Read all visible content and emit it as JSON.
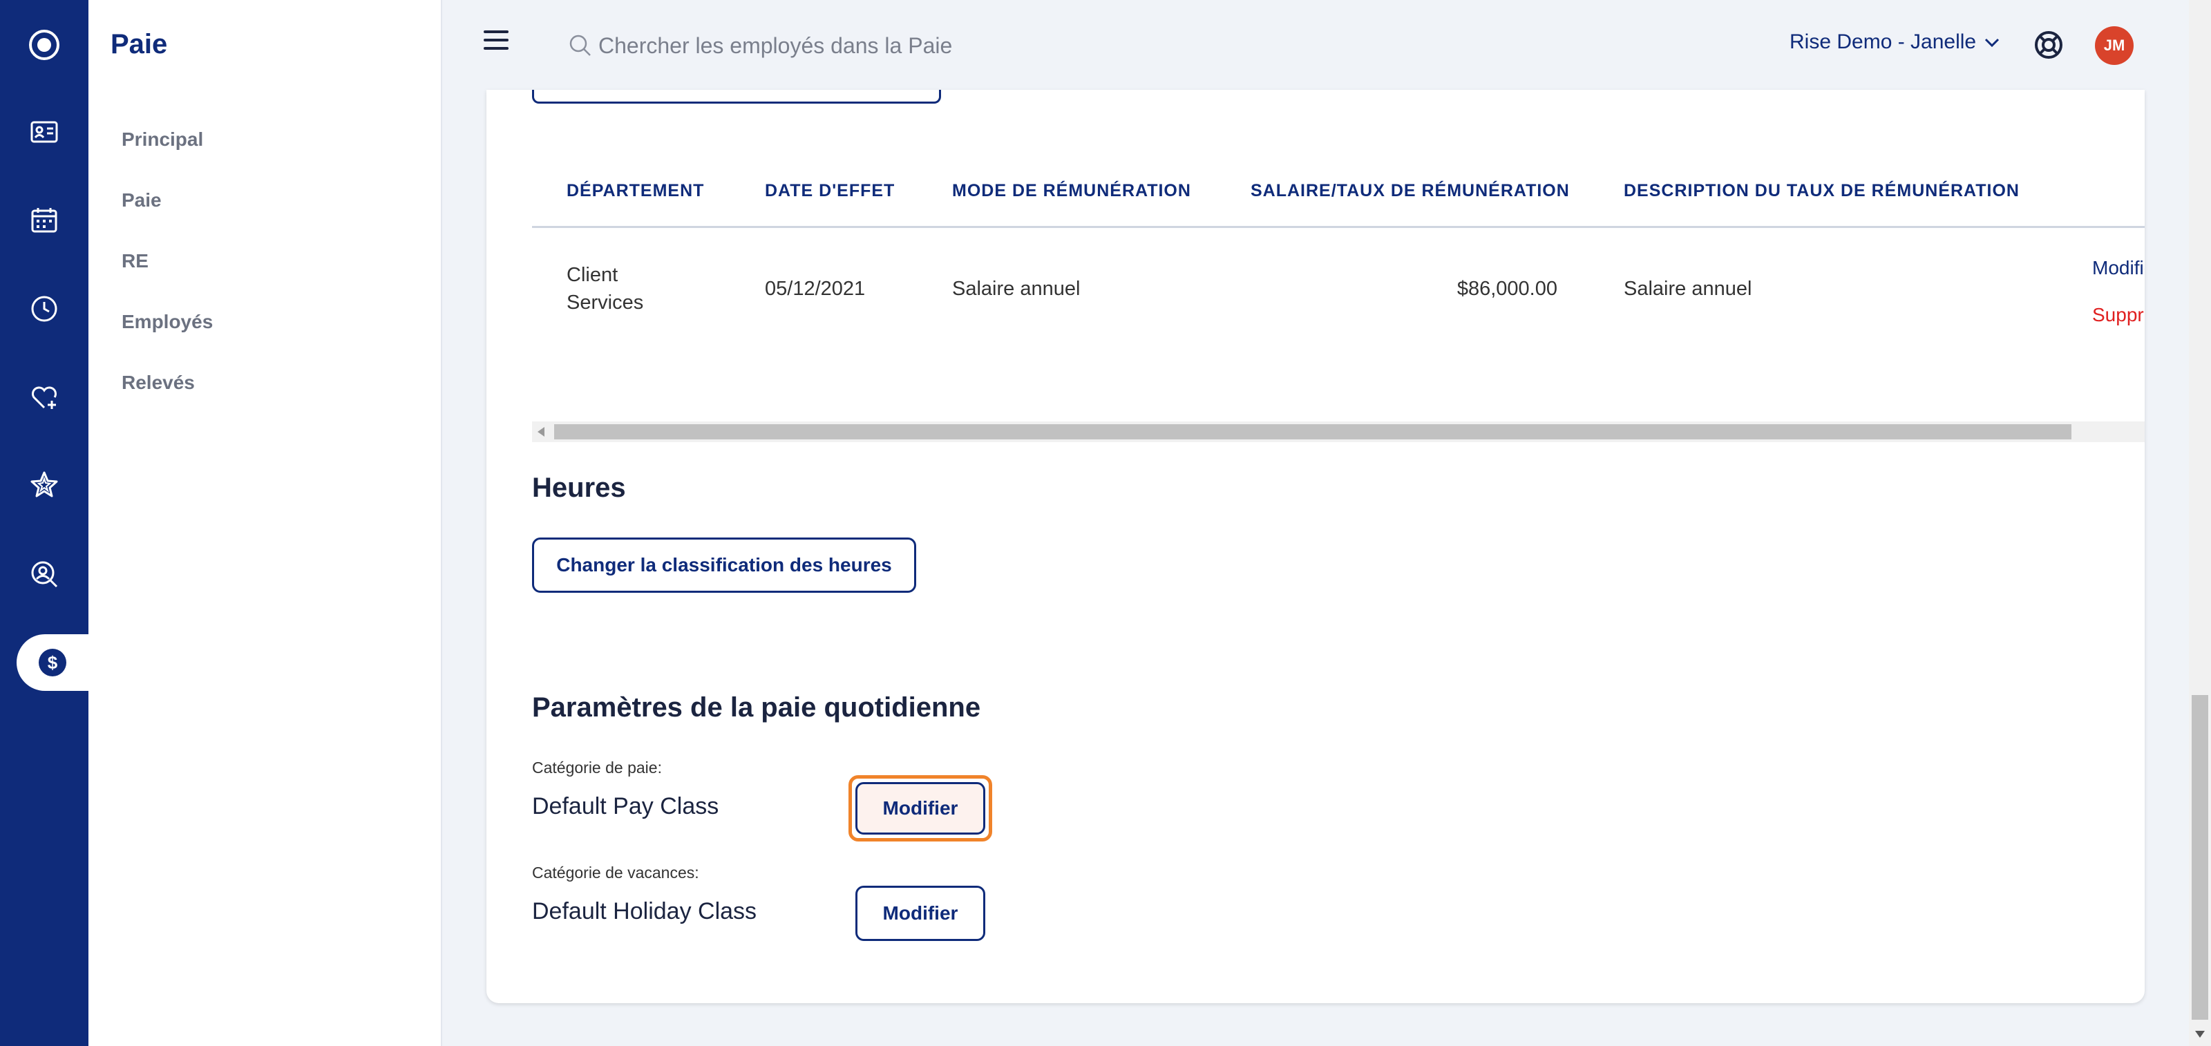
{
  "nav_rail": {
    "items": [
      {
        "icon": "logo-circle-icon"
      },
      {
        "icon": "id-card-icon"
      },
      {
        "icon": "calendar-icon"
      },
      {
        "icon": "clock-icon"
      },
      {
        "icon": "heart-plus-icon"
      },
      {
        "icon": "star-icon"
      },
      {
        "icon": "search-person-icon"
      },
      {
        "icon": "dollar-icon",
        "active": true,
        "glyph": "$"
      }
    ]
  },
  "sidebar": {
    "title": "Paie",
    "items": [
      {
        "label": "Principal"
      },
      {
        "label": "Paie"
      },
      {
        "label": "RE"
      },
      {
        "label": "Employés"
      },
      {
        "label": "Relevés"
      }
    ]
  },
  "header": {
    "search_placeholder": "Chercher les employés dans la Paie",
    "account_label": "Rise Demo - Janelle",
    "avatar_initials": "JM"
  },
  "compensation_table": {
    "columns": [
      "DÉPARTEMENT",
      "DATE D'EFFET",
      "MODE DE RÉMUNÉRATION",
      "SALAIRE/TAUX DE RÉMUNÉRATION",
      "DESCRIPTION DU TAUX DE RÉMUNÉRATION"
    ],
    "rows": [
      {
        "department_line1": "Client",
        "department_line2": "Services",
        "effective_date": "05/12/2021",
        "pay_mode": "Salaire annuel",
        "rate": "$86,000.00",
        "rate_description": "Salaire annuel",
        "edit_label": "Modifier",
        "delete_label": "Supprimer"
      }
    ]
  },
  "hours": {
    "title": "Heures",
    "change_button": "Changer la classification des heures"
  },
  "daily_pay": {
    "title": "Paramètres de la paie quotidienne",
    "pay_category_label": "Catégorie de paie:",
    "pay_category_value": "Default Pay Class",
    "pay_category_button": "Modifier",
    "holiday_category_label": "Catégorie de vacances:",
    "holiday_category_value": "Default Holiday Class",
    "holiday_category_button": "Modifier"
  },
  "colors": {
    "brand_navy": "#0f2b7a",
    "delete_red": "#e02020",
    "focus_orange": "#f0832a",
    "avatar_red": "#d9432b"
  }
}
